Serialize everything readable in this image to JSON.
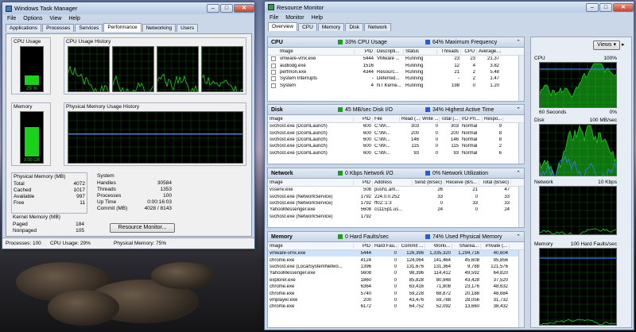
{
  "task_manager": {
    "title": "Windows Task Manager",
    "menu": [
      "File",
      "Options",
      "View",
      "Help"
    ],
    "tabs": [
      "Applications",
      "Processes",
      "Services",
      "Performance",
      "Networking",
      "Users"
    ],
    "cpu_usage_label": "CPU Usage",
    "cpu_history_label": "CPU Usage History",
    "cpu_percent_text": "29 %",
    "cpu_level": 0.29,
    "memory_label": "Memory",
    "mem_history_label": "Physical Memory Usage History",
    "mem_text": "3.00 GB",
    "mem_level": 0.75,
    "physical_memory": {
      "title": "Physical Memory (MB)",
      "rows": [
        [
          "Total",
          "4072"
        ],
        [
          "Cached",
          "1017"
        ],
        [
          "Available",
          "997"
        ],
        [
          "Free",
          "11"
        ]
      ]
    },
    "kernel_memory": {
      "title": "Kernel Memory (MB)",
      "rows": [
        [
          "Paged",
          "184"
        ],
        [
          "Nonpaged",
          "105"
        ]
      ]
    },
    "system": {
      "title": "System",
      "rows": [
        [
          "Handles",
          "30584"
        ],
        [
          "Threads",
          "1353"
        ],
        [
          "Processes",
          "100"
        ],
        [
          "Up Time",
          "0:00:16:03"
        ],
        [
          "Commit (MB)",
          "4028 / 8143"
        ]
      ]
    },
    "resource_monitor_button": "Resource Monitor...",
    "status": {
      "processes": "Processes: 100",
      "cpu": "CPU Usage: 29%",
      "memory": "Physical Memory: 75%"
    }
  },
  "resource_monitor": {
    "title": "Resource Monitor",
    "menu": [
      "File",
      "Monitor",
      "Help"
    ],
    "tabs": [
      "Overview",
      "CPU",
      "Memory",
      "Disk",
      "Network"
    ],
    "views_button": "Views",
    "colors": {
      "green": "#1aa01a",
      "blue": "#2a5bd7"
    },
    "cpu": {
      "name": "CPU",
      "ind1": "33% CPU Usage",
      "ind2": "64% Maximum Frequency",
      "headers": [
        "Image",
        "PID",
        "Descripti...",
        "Status",
        "Threads",
        "CPU",
        "Average..."
      ],
      "rows": [
        [
          "vmware-vmx.exe",
          "5444",
          "VMware ...",
          "Running",
          "23",
          "23",
          "21.37"
        ],
        [
          "audiodg.exe",
          "1516",
          "",
          "Running",
          "12",
          "4",
          "3.82"
        ],
        [
          "perfmon.exe",
          "4344",
          "Resourc...",
          "Running",
          "21",
          "2",
          "5.48"
        ],
        [
          "System Interrupts",
          "-",
          "Deferred...",
          "Running",
          "-",
          "2",
          "1.47"
        ],
        [
          "System",
          "4",
          "NT Kerne...",
          "Running",
          "198",
          "0",
          "1.20"
        ]
      ]
    },
    "disk": {
      "name": "Disk",
      "ind1": "45 MB/sec Disk I/O",
      "ind2": "34% Highest Active Time",
      "headers": [
        "Image",
        "PID",
        "File",
        "Read (...",
        "Write ...",
        "Total (...",
        "I/O Pri...",
        "Respo..."
      ],
      "rows": [
        [
          "svchost.exe (DcomLaunch)",
          "600",
          "C:\\Wi...",
          "303",
          "0",
          "303",
          "Normal",
          "9"
        ],
        [
          "svchost.exe (DcomLaunch)",
          "600",
          "C:\\Wi...",
          "200",
          "0",
          "200",
          "Normal",
          "8"
        ],
        [
          "svchost.exe (DcomLaunch)",
          "600",
          "C:\\Wi...",
          "146",
          "0",
          "146",
          "Normal",
          "8"
        ],
        [
          "svchost.exe (DcomLaunch)",
          "600",
          "C:\\Wi...",
          "115",
          "0",
          "115",
          "Normal",
          "2"
        ],
        [
          "svchost.exe (DcomLaunch)",
          "600",
          "C:\\Wi...",
          "93",
          "0",
          "93",
          "Normal",
          "6"
        ]
      ]
    },
    "network": {
      "name": "Network",
      "ind1": "0 Kbps Network I/O",
      "ind2": "0% Network Utilization",
      "headers": [
        "Image",
        "PID",
        "Address",
        "Send (B/sec)",
        "Receive (B/s...",
        "Total (B/sec)"
      ],
      "rows": [
        [
          "vssenv.exe",
          "508",
          "push1.am...",
          "26",
          "21",
          "47"
        ],
        [
          "svchost.exe (NetworkService)",
          "1792",
          "224.0.0.252",
          "33",
          "0",
          "33"
        ],
        [
          "svchost.exe (NetworkService)",
          "1792",
          "ff02::1:3",
          "0",
          "33",
          "33"
        ],
        [
          "YahooMessenger.exe",
          "5608",
          "cs115p1.us...",
          "24",
          "0",
          "24"
        ],
        [
          "svchost.exe (NetworkService)",
          "1792",
          "",
          "",
          "",
          ""
        ]
      ]
    },
    "memory": {
      "name": "Memory",
      "ind1": "0 Hard Faults/sec",
      "ind2": "74% Used Physical Memory",
      "headers": [
        "Image",
        "PID",
        "Hard Fau...",
        "Commit ...",
        "Worki...",
        "Sharea...",
        "Private (..."
      ],
      "rows": [
        [
          "vmware-vmx.exe",
          "5444",
          "0",
          "126,396",
          "1,335,320",
          "1,294,716",
          "40,604"
        ],
        [
          "chrome.exe",
          "4124",
          "0",
          "124,064",
          "141,464",
          "45,608",
          "95,856"
        ],
        [
          "svchost.exe (LocalSystemNetwo...",
          "1396",
          "0",
          "131,676",
          "131,364",
          "9,788",
          "121,576"
        ],
        [
          "YahooMessenger.exe",
          "5608",
          "0",
          "98,396",
          "114,412",
          "49,592",
          "64,820"
        ],
        [
          "explorer.exe",
          "1860",
          "0",
          "85,828",
          "80,948",
          "43,428",
          "37,520"
        ],
        [
          "chrome.exe",
          "6364",
          "0",
          "63,416",
          "71,808",
          "23,176",
          "48,632"
        ],
        [
          "chrome.exe",
          "5740",
          "0",
          "59,228",
          "68,872",
          "20,188",
          "48,684"
        ],
        [
          "vmplayer.exe",
          "200",
          "0",
          "43,476",
          "59,788",
          "28,056",
          "31,732"
        ],
        [
          "chrome.exe",
          "6172",
          "0",
          "64,752",
          "52,092",
          "13,660",
          "38,432"
        ]
      ]
    },
    "right_panel": {
      "cpu": {
        "label": "CPU",
        "max": "100%",
        "footer_left": "60 Seconds",
        "footer_right": "0%"
      },
      "disk": {
        "label": "Disk",
        "max": "100 MB/sec"
      },
      "network": {
        "label": "Network",
        "max": "10 Kbps"
      },
      "memory": {
        "label": "Memory",
        "max": "100 Hard Faults/sec"
      }
    }
  }
}
